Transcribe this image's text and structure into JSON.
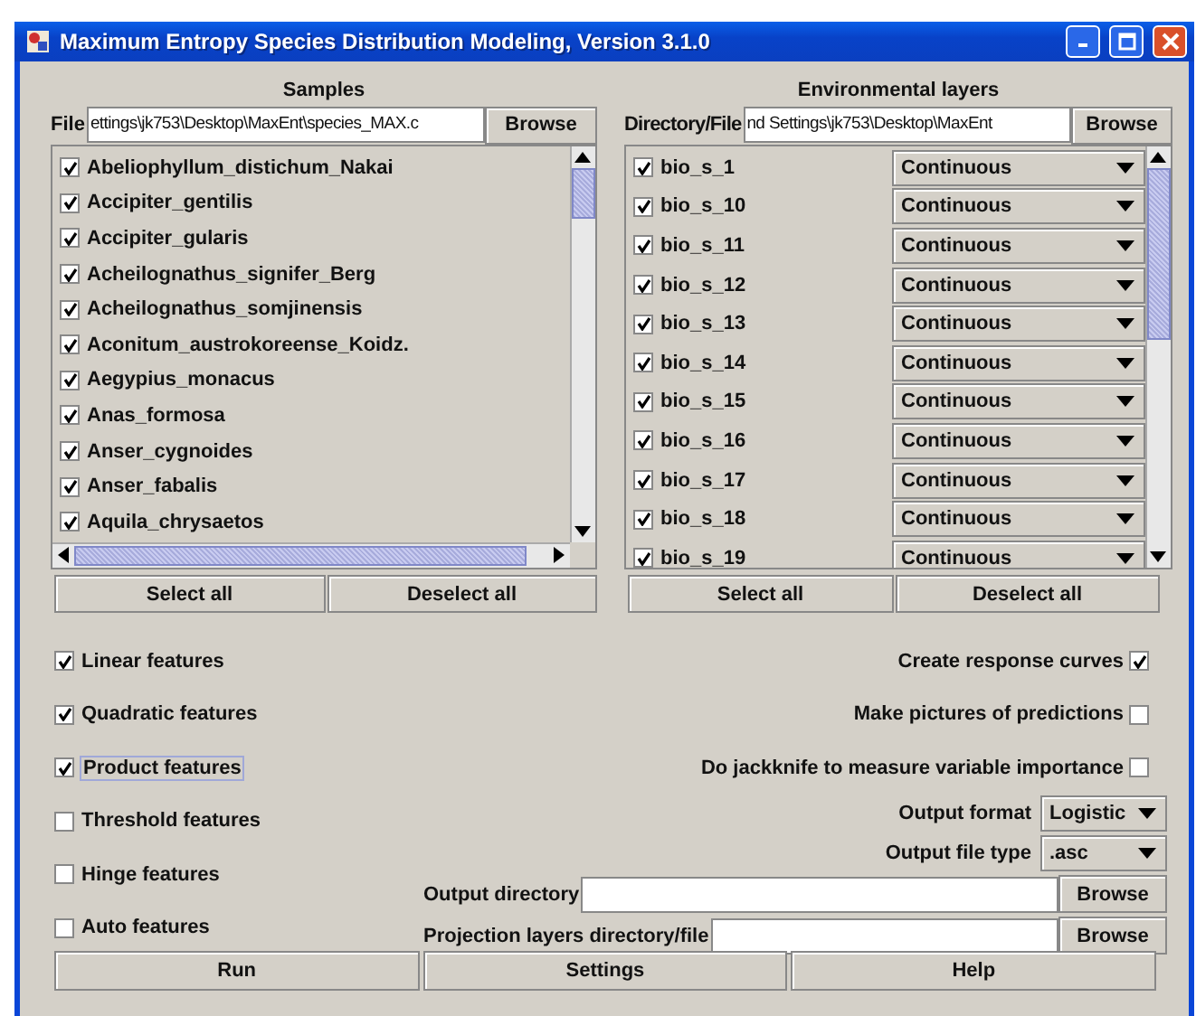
{
  "window": {
    "title": "Maximum Entropy Species Distribution Modeling, Version 3.1.0"
  },
  "samples": {
    "heading": "Samples",
    "file_label": "File",
    "file_value": "ettings\\jk753\\Desktop\\MaxEnt\\species_MAX.c",
    "browse": "Browse",
    "select_all": "Select all",
    "deselect_all": "Deselect all",
    "species": [
      {
        "name": "Abeliophyllum_distichum_Nakai",
        "checked": true
      },
      {
        "name": "Accipiter_gentilis",
        "checked": true
      },
      {
        "name": "Accipiter_gularis",
        "checked": true
      },
      {
        "name": "Acheilognathus_signifer_Berg",
        "checked": true
      },
      {
        "name": "Acheilognathus_somjinensis",
        "checked": true
      },
      {
        "name": "Aconitum_austrokoreense_Koidz.",
        "checked": true
      },
      {
        "name": "Aegypius_monacus",
        "checked": true
      },
      {
        "name": "Anas_formosa",
        "checked": true
      },
      {
        "name": "Anser_cygnoides",
        "checked": true
      },
      {
        "name": "Anser_fabalis",
        "checked": true
      },
      {
        "name": "Aquila_chrysaetos",
        "checked": true
      }
    ]
  },
  "environmental_layers": {
    "heading": "Environmental layers",
    "file_label": "Directory/File",
    "file_value": "nd Settings\\jk753\\Desktop\\MaxEnt",
    "browse": "Browse",
    "select_all": "Select all",
    "deselect_all": "Deselect all",
    "layers": [
      {
        "name": "bio_s_1",
        "checked": true,
        "type": "Continuous"
      },
      {
        "name": "bio_s_10",
        "checked": true,
        "type": "Continuous"
      },
      {
        "name": "bio_s_11",
        "checked": true,
        "type": "Continuous"
      },
      {
        "name": "bio_s_12",
        "checked": true,
        "type": "Continuous"
      },
      {
        "name": "bio_s_13",
        "checked": true,
        "type": "Continuous"
      },
      {
        "name": "bio_s_14",
        "checked": true,
        "type": "Continuous"
      },
      {
        "name": "bio_s_15",
        "checked": true,
        "type": "Continuous"
      },
      {
        "name": "bio_s_16",
        "checked": true,
        "type": "Continuous"
      },
      {
        "name": "bio_s_17",
        "checked": true,
        "type": "Continuous"
      },
      {
        "name": "bio_s_18",
        "checked": true,
        "type": "Continuous"
      },
      {
        "name": "bio_s_19",
        "checked": true,
        "type": "Continuous"
      }
    ]
  },
  "features": [
    {
      "label": "Linear features",
      "checked": true,
      "focused": false
    },
    {
      "label": "Quadratic features",
      "checked": true,
      "focused": false
    },
    {
      "label": "Product features",
      "checked": true,
      "focused": true
    },
    {
      "label": "Threshold features",
      "checked": false,
      "focused": false
    },
    {
      "label": "Hinge features",
      "checked": false,
      "focused": false
    },
    {
      "label": "Auto features",
      "checked": false,
      "focused": false
    }
  ],
  "options": [
    {
      "label": "Create response curves",
      "checked": true
    },
    {
      "label": "Make pictures of predictions",
      "checked": false
    },
    {
      "label": "Do jackknife to measure variable importance",
      "checked": false
    }
  ],
  "output_format": {
    "label": "Output format",
    "value": "Logistic"
  },
  "output_file_type": {
    "label": "Output file type",
    "value": ".asc"
  },
  "output_directory": {
    "label": "Output directory",
    "browse": "Browse"
  },
  "projection_layers": {
    "label": "Projection layers directory/file",
    "browse": "Browse"
  },
  "buttons": [
    "Run",
    "Settings",
    "Help"
  ]
}
